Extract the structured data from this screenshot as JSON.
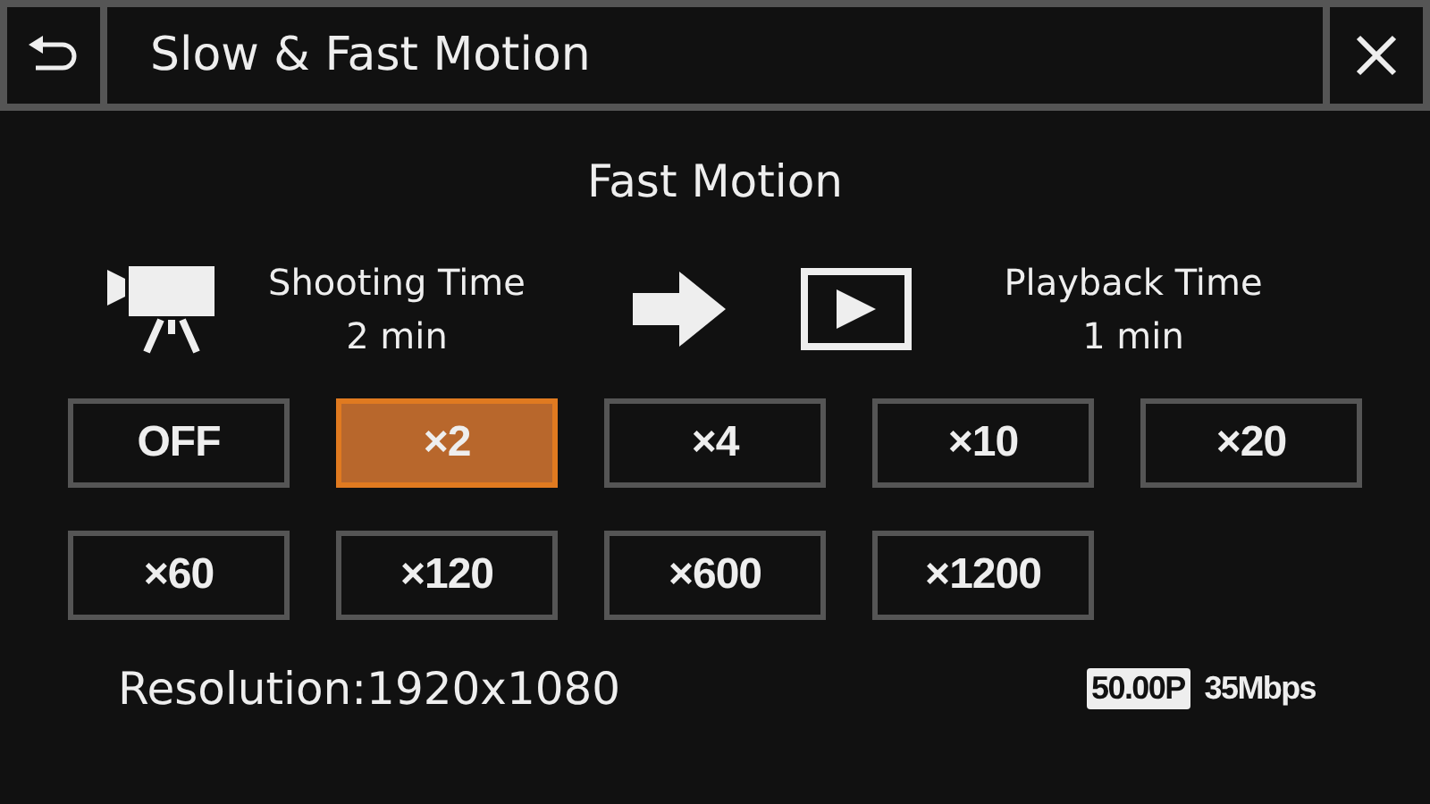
{
  "header": {
    "title": "Slow & Fast Motion"
  },
  "mode_title": "Fast Motion",
  "shooting": {
    "label": "Shooting Time",
    "value": "2 min"
  },
  "playback": {
    "label": "Playback Time",
    "value": "1 min"
  },
  "speeds": [
    {
      "label": "OFF",
      "selected": false
    },
    {
      "label": "×2",
      "selected": true
    },
    {
      "label": "×4",
      "selected": false
    },
    {
      "label": "×10",
      "selected": false
    },
    {
      "label": "×20",
      "selected": false
    },
    {
      "label": "×60",
      "selected": false
    },
    {
      "label": "×120",
      "selected": false
    },
    {
      "label": "×600",
      "selected": false
    },
    {
      "label": "×1200",
      "selected": false
    }
  ],
  "footer": {
    "resolution": "Resolution:1920x1080",
    "frame_rate": "50.00P",
    "bitrate": "35Mbps"
  }
}
